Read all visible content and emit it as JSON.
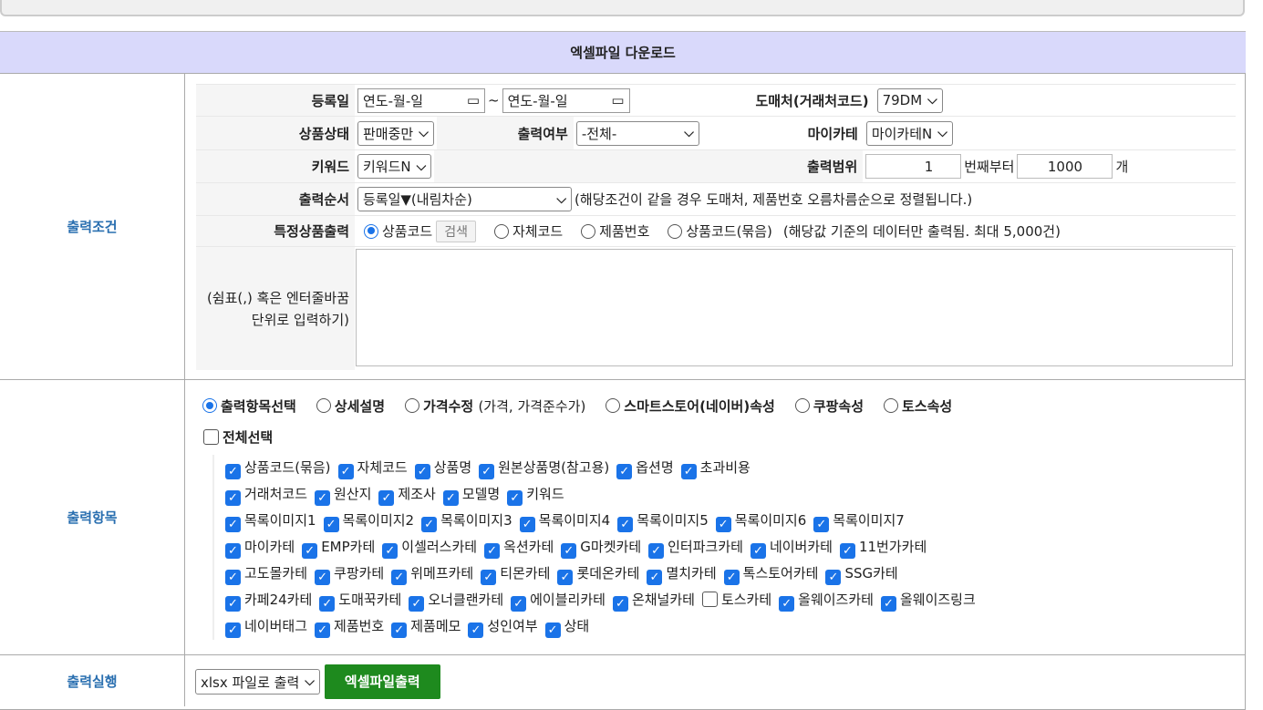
{
  "header": {
    "title": "엑셀파일 다운로드"
  },
  "conditions": {
    "section_label": "출력조건",
    "reg_date_label": "등록일",
    "date_from": "연도-월-일",
    "date_sep": "~",
    "date_to": "연도-월-일",
    "wholesaler_label": "도매처(거래처코드)",
    "wholesaler_value": "79DM",
    "status_label": "상품상태",
    "status_value": "판매중만",
    "output_flag_label": "출력여부",
    "output_flag_value": "-전체-",
    "mycate_label": "마이카테",
    "mycate_value": "마이카테N",
    "keyword_label": "키워드",
    "keyword_value": "키워드N",
    "range_label": "출력범위",
    "range_from": "1",
    "range_mid": "번째부터",
    "range_to": "1000",
    "range_unit": "개",
    "order_label": "출력순서",
    "order_value": "등록일▼(내림차순)",
    "order_note": "(해당조건이 같을 경우 도매처, 제품번호 오름차름순으로 정렬됩니다.)",
    "specific_label": "특정상품출력",
    "specific_options": [
      "상품코드",
      "자체코드",
      "제품번호",
      "상품코드(묶음)"
    ],
    "search_button": "검색",
    "specific_note": "(해당값 기준의 데이터만 출력됨. 최대 5,000건)",
    "textarea_hint": "(쉼표(,) 혹은 엔터줄바꿈 단위로 입력하기)",
    "textarea_value": ""
  },
  "items": {
    "section_label": "출력항목",
    "modes": [
      {
        "label": "출력항목선택",
        "checked": true
      },
      {
        "label": "상세설명"
      },
      {
        "label": "가격수정",
        "sub": "(가격, 가격준수가)"
      },
      {
        "label": "스마트스토어(네이버)속성"
      },
      {
        "label": "쿠팡속성"
      },
      {
        "label": "토스속성"
      }
    ],
    "select_all": "전체선택",
    "rows": [
      [
        [
          "상품코드(묶음)",
          1
        ],
        [
          "자체코드",
          1
        ],
        [
          "상품명",
          1
        ],
        [
          "원본상품명(참고용)",
          1
        ],
        [
          "옵션명",
          1
        ],
        [
          "초과비용",
          1
        ]
      ],
      [
        [
          "거래처코드",
          1
        ],
        [
          "원산지",
          1
        ],
        [
          "제조사",
          1
        ],
        [
          "모델명",
          1
        ],
        [
          "키워드",
          1
        ]
      ],
      [
        [
          "목록이미지1",
          1
        ],
        [
          "목록이미지2",
          1
        ],
        [
          "목록이미지3",
          1
        ],
        [
          "목록이미지4",
          1
        ],
        [
          "목록이미지5",
          1
        ],
        [
          "목록이미지6",
          1
        ],
        [
          "목록이미지7",
          1
        ]
      ],
      [
        [
          "마이카테",
          1
        ],
        [
          "EMP카테",
          1
        ],
        [
          "이셀러스카테",
          1
        ],
        [
          "옥션카테",
          1
        ],
        [
          "G마켓카테",
          1
        ],
        [
          "인터파크카테",
          1
        ],
        [
          "네이버카테",
          1
        ],
        [
          "11번가카테",
          1
        ]
      ],
      [
        [
          "고도몰카테",
          1
        ],
        [
          "쿠팡카테",
          1
        ],
        [
          "위메프카테",
          1
        ],
        [
          "티몬카테",
          1
        ],
        [
          "롯데온카테",
          1
        ],
        [
          "멸치카테",
          1
        ],
        [
          "톡스토어카테",
          1
        ],
        [
          "SSG카테",
          1
        ]
      ],
      [
        [
          "카페24카테",
          1
        ],
        [
          "도매꾹카테",
          1
        ],
        [
          "오너클랜카테",
          1
        ],
        [
          "에이블리카테",
          1
        ],
        [
          "온채널카테",
          1
        ],
        [
          "토스카테",
          0
        ],
        [
          "올웨이즈카테",
          1
        ],
        [
          "올웨이즈링크",
          1
        ]
      ],
      [
        [
          "네이버태그",
          1
        ],
        [
          "제품번호",
          1
        ],
        [
          "제품메모",
          1
        ],
        [
          "성인여부",
          1
        ],
        [
          "상태",
          1
        ]
      ]
    ]
  },
  "execute": {
    "section_label": "출력실행",
    "format_value": "xlsx 파일로 출력",
    "button": "엑셀파일출력"
  }
}
